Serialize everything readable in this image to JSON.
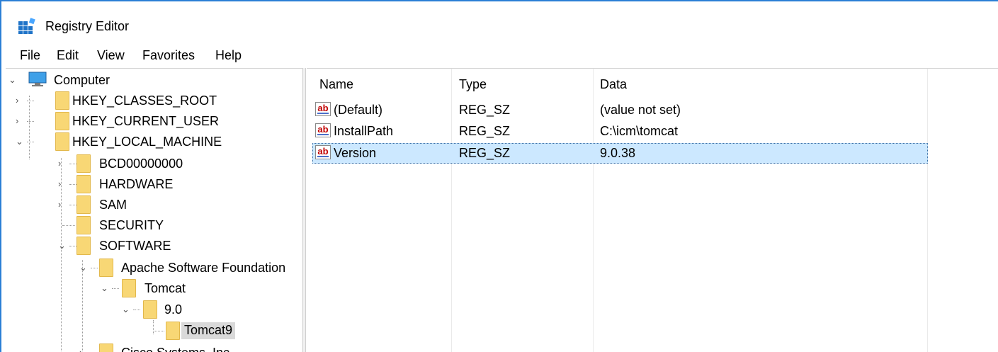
{
  "window": {
    "title": "Registry Editor"
  },
  "menu": [
    "File",
    "Edit",
    "View",
    "Favorites",
    "Help"
  ],
  "tree": {
    "root": "Computer",
    "hives": [
      "HKEY_CLASSES_ROOT",
      "HKEY_CURRENT_USER",
      "HKEY_LOCAL_MACHINE"
    ],
    "hklm_children": [
      "BCD00000000",
      "HARDWARE",
      "SAM",
      "SECURITY",
      "SOFTWARE"
    ],
    "software_children": [
      "Apache Software Foundation"
    ],
    "apache_children": [
      "Tomcat"
    ],
    "tomcat_children": [
      "9.0"
    ],
    "v90_children": [
      "Tomcat9"
    ],
    "partial": "Cisco Systems, Inc."
  },
  "list": {
    "columns": [
      "Name",
      "Type",
      "Data"
    ],
    "rows": [
      {
        "name": "(Default)",
        "type": "REG_SZ",
        "data": "(value not set)"
      },
      {
        "name": "InstallPath",
        "type": "REG_SZ",
        "data": "C:\\icm\\tomcat"
      },
      {
        "name": "Version",
        "type": "REG_SZ",
        "data": "9.0.38"
      }
    ]
  },
  "colors": {
    "accent": "#2b7fd6",
    "selection": "#cce8ff",
    "folder": "#f8d775"
  }
}
